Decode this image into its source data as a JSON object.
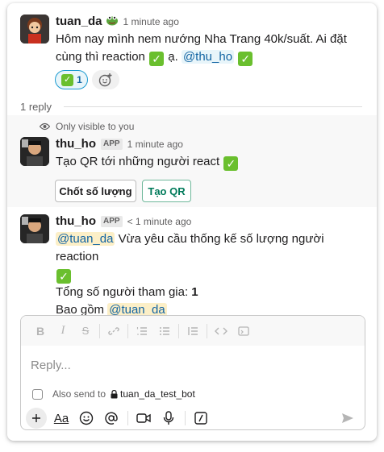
{
  "thread": {
    "parent": {
      "author": "tuan_da",
      "time": "1 minute ago",
      "text_main": "Hôm nay mình nem nướng Nha Trang 40k/suất. Ai đặt",
      "text_line2_a": "cùng thì reaction",
      "text_line2_b": "ạ.",
      "mention": "@thu_ho",
      "reaction_count": "1"
    },
    "reply_count_label": "1 reply",
    "ephemeral": {
      "notice": "Only visible to you",
      "author": "thu_ho",
      "badge": "APP",
      "time": "1 minute ago",
      "text": "Tạo QR tới những người react",
      "button_1": "Chốt số lượng",
      "button_2": "Tạo QR"
    },
    "summary": {
      "author": "thu_ho",
      "badge": "APP",
      "time": "< 1 minute ago",
      "mention_1": "@tuan_da",
      "text_1": " Vừa yêu cầu thống kế số lượng người reaction",
      "line_total_label": "Tổng số người tham gia: ",
      "line_total_value": "1",
      "line_include": "Bao gồm ",
      "mention_2": "@tuan_da"
    }
  },
  "composer": {
    "placeholder": "Reply...",
    "also_send_label": "Also send to",
    "bot_name": "tuan_da_test_bot"
  },
  "colors": {
    "accent": "#1264a3",
    "reaction_green": "#6abf2e",
    "primary_button": "#007a5a"
  }
}
